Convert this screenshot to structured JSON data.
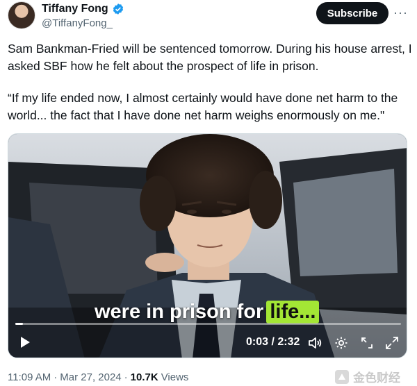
{
  "author": {
    "display_name": "Tiffany Fong",
    "handle": "@TiffanyFong_",
    "verified": true
  },
  "actions": {
    "subscribe_label": "Subscribe",
    "more_label": "···"
  },
  "tweet": {
    "paragraph1": "Sam Bankman-Fried will be sentenced tomorrow. During his house arrest, I asked SBF how he felt about the prospect of life in prison.",
    "paragraph2": "“If my life ended now, I almost certainly would have done net harm to the world... the fact that I have done net harm weighs enormously on me.\""
  },
  "video": {
    "caption_main": "were in prison for",
    "caption_highlight": "life...",
    "current_time": "0:03",
    "separator": "/",
    "duration": "2:32",
    "progress_fraction": 0.02
  },
  "meta": {
    "time": "11:09 AM",
    "dot1": "·",
    "date": "Mar 27, 2024",
    "dot2": "·",
    "views_count": "10.7K",
    "views_label": "Views"
  },
  "watermark": {
    "text": "金色财经"
  },
  "colors": {
    "accent": "#1d9bf0",
    "caption_highlight": "#a3e635",
    "subscribe_bg": "#0f1419"
  }
}
